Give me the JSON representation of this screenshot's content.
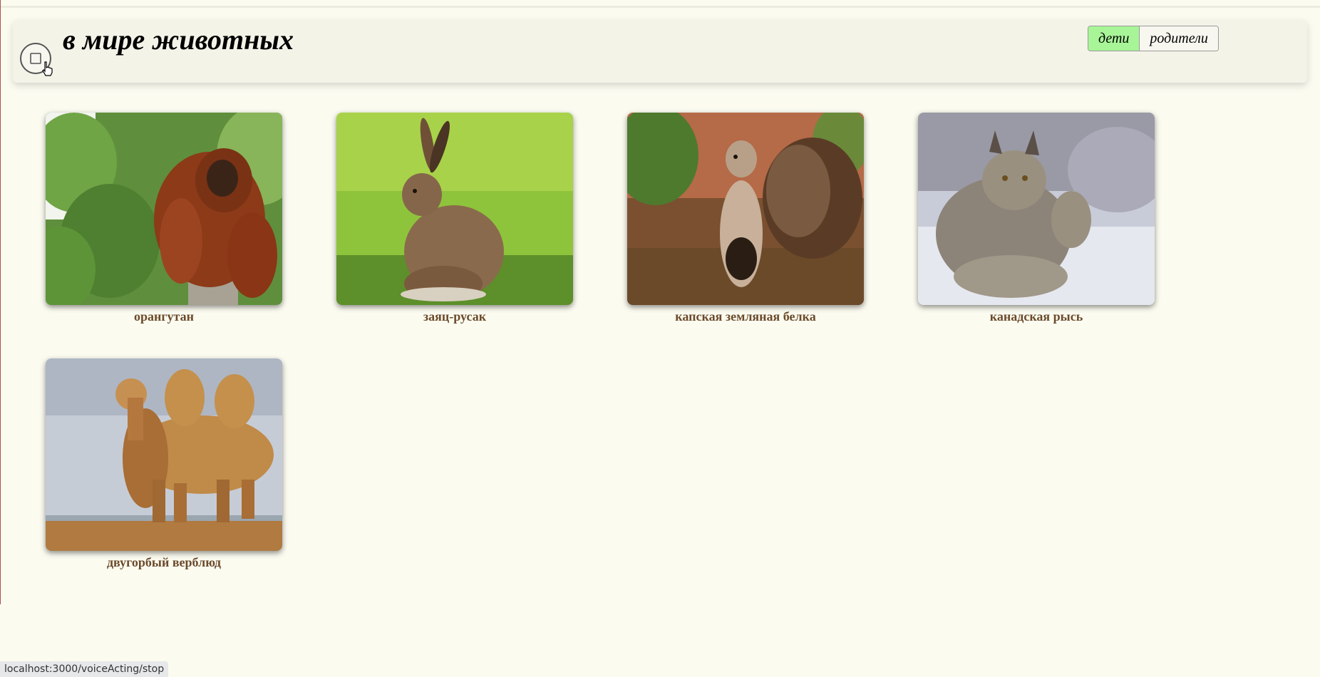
{
  "header": {
    "title": "в мире животных",
    "stop_icon": "stop-square-icon",
    "cursor_icon": "hand-pointer-icon",
    "audience_tabs": [
      {
        "label": "дети",
        "active": true
      },
      {
        "label": "родители",
        "active": false
      }
    ],
    "colors": {
      "active_tab": "#a8f598",
      "caption": "#6b4a2a",
      "page_background": "#fbfbf0"
    }
  },
  "animals": [
    {
      "caption": "орангутан",
      "image": "orangutan-photo"
    },
    {
      "caption": "заяц-русак",
      "image": "hare-photo"
    },
    {
      "caption": "капская земляная белка",
      "image": "ground-squirrel-photo"
    },
    {
      "caption": "канадская рысь",
      "image": "lynx-photo"
    },
    {
      "caption": "двугорбый верблюд",
      "image": "camel-photo"
    }
  ],
  "status_bar": {
    "url": "localhost:3000/voiceActing/stop"
  }
}
